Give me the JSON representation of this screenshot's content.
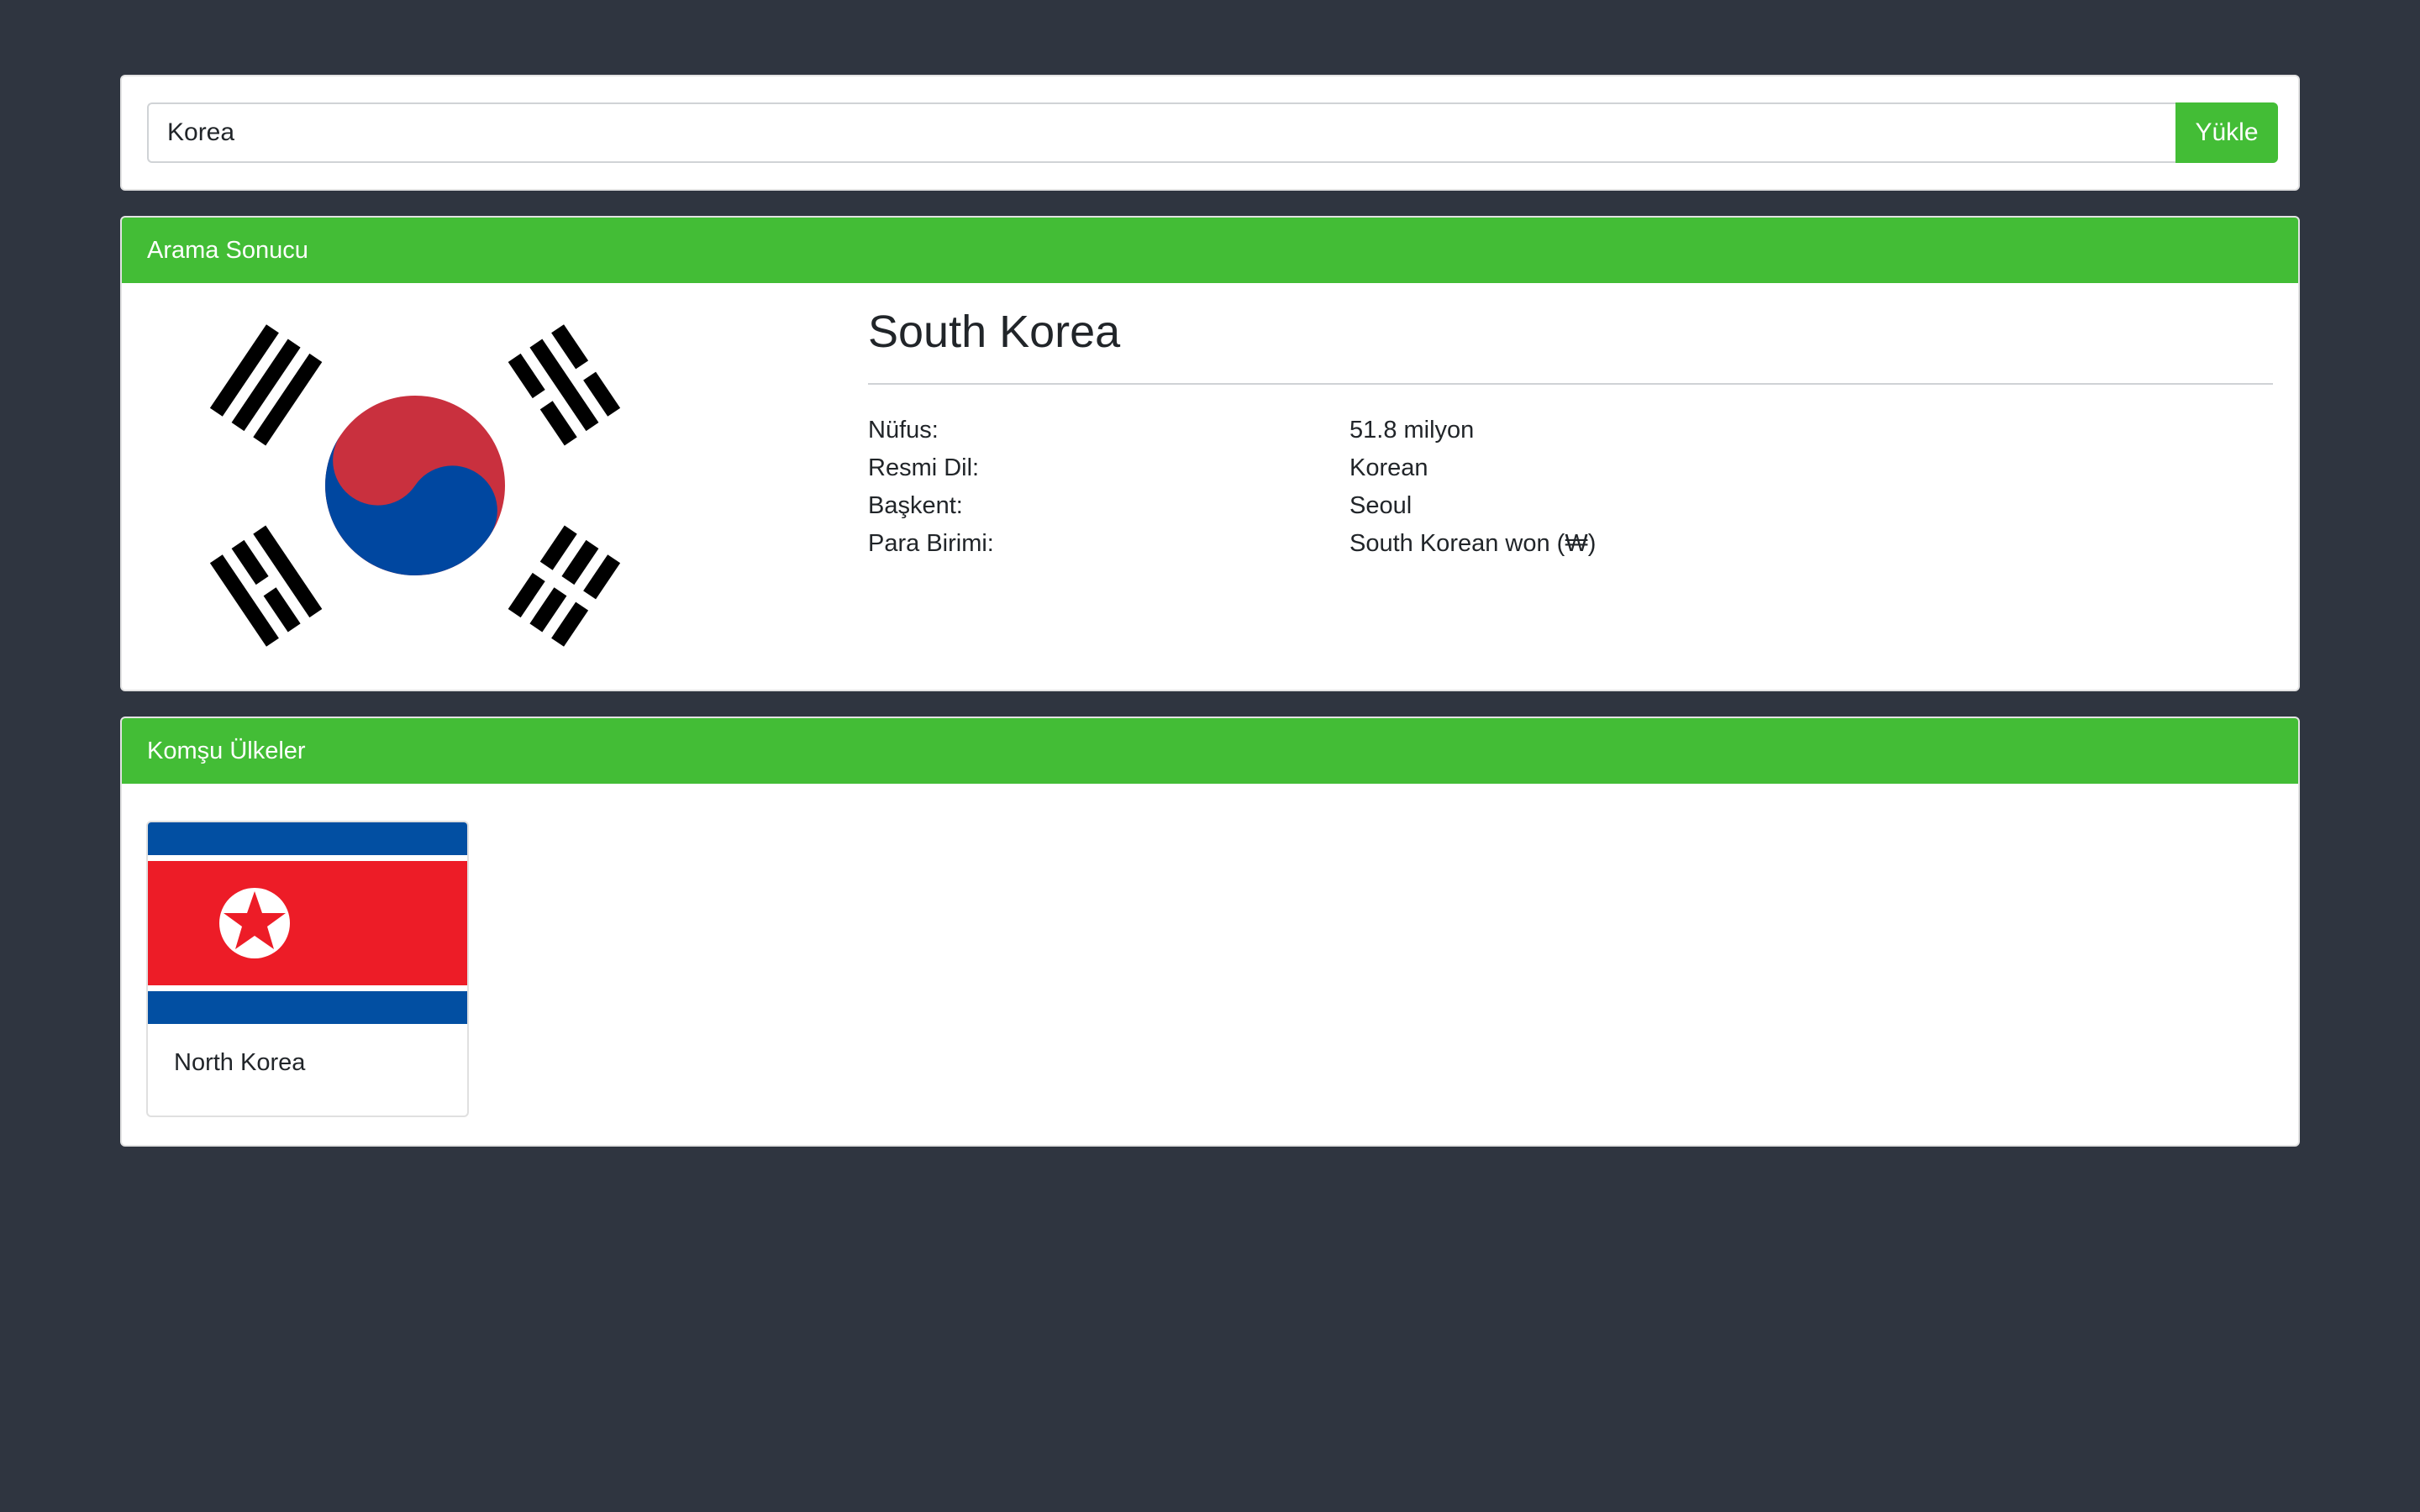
{
  "search": {
    "value": "Korea",
    "button_label": "Yükle"
  },
  "result": {
    "header": "Arama Sonucu",
    "country_name": "South Korea",
    "flag_icon": "south-korea-flag",
    "details": [
      {
        "label": "Nüfus:",
        "value": "51.8 milyon"
      },
      {
        "label": "Resmi Dil:",
        "value": "Korean"
      },
      {
        "label": "Başkent:",
        "value": "Seoul"
      },
      {
        "label": "Para Birimi:",
        "value": "South Korean won (₩)"
      }
    ]
  },
  "neighbors": {
    "header": "Komşu Ülkeler",
    "items": [
      {
        "name": "North Korea",
        "flag_icon": "north-korea-flag"
      }
    ]
  },
  "colors": {
    "background": "#2f3540",
    "accent": "#43bd36",
    "card": "#ffffff"
  }
}
